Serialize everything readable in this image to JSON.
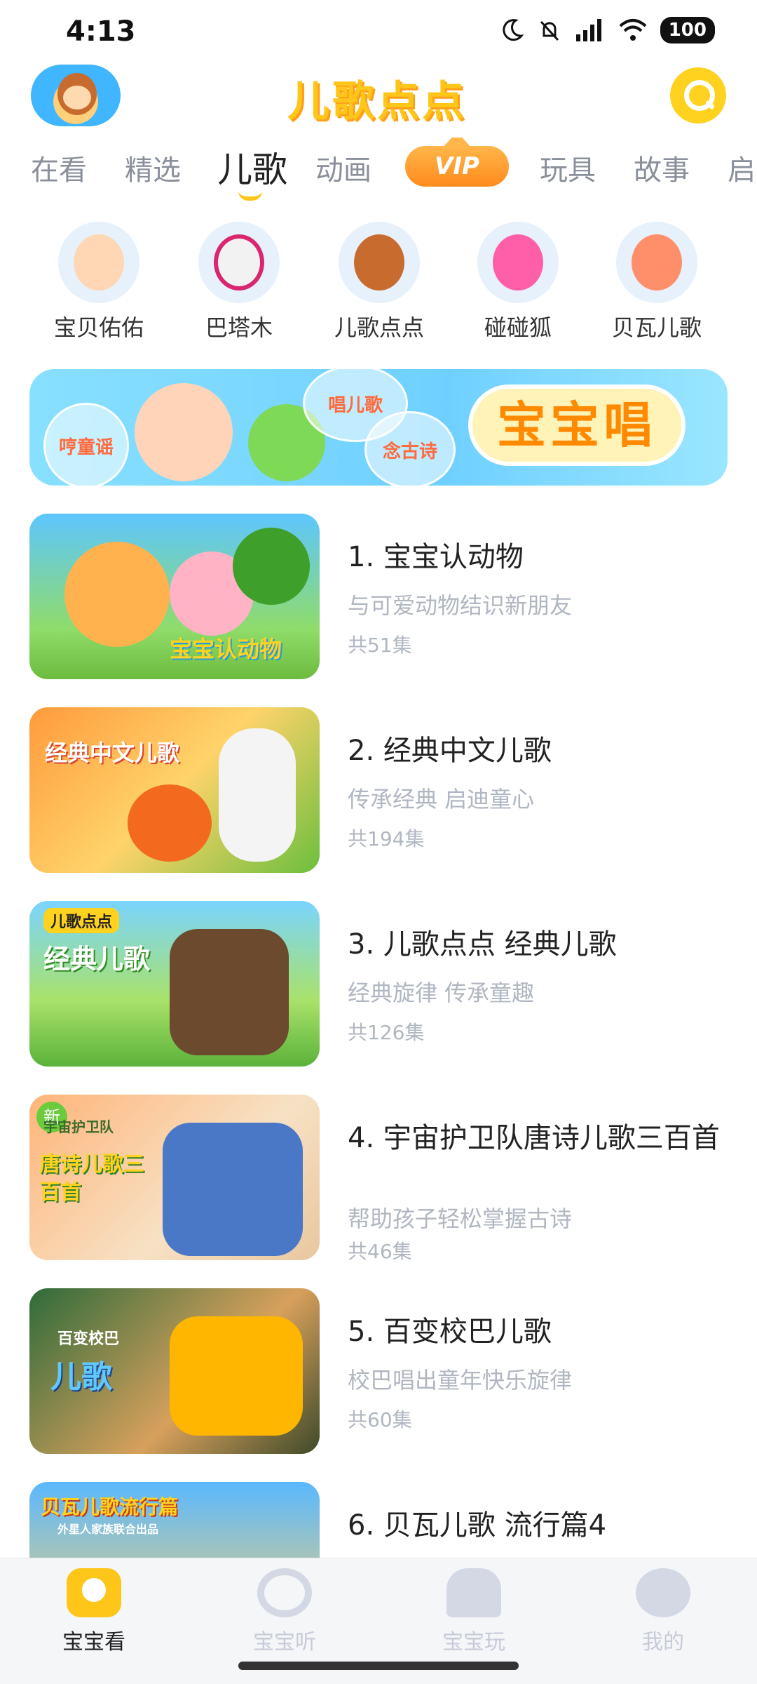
{
  "status_bar": {
    "time": "4:13",
    "battery": "100",
    "icons": [
      "moon-icon",
      "bell-off-icon",
      "signal-icon",
      "wifi-icon"
    ]
  },
  "header": {
    "logo_text": "儿歌点点",
    "search_icon": "search-icon",
    "accent": "#ffc61a"
  },
  "tabs": [
    {
      "label": "在看"
    },
    {
      "label": "精选"
    },
    {
      "label": "儿歌",
      "active": true
    },
    {
      "label": "动画"
    },
    {
      "label": "VIP"
    },
    {
      "label": "玩具"
    },
    {
      "label": "故事"
    },
    {
      "label": "启"
    }
  ],
  "characters": [
    {
      "name": "宝贝佑佑"
    },
    {
      "name": "巴塔木"
    },
    {
      "name": "儿歌点点"
    },
    {
      "name": "碰碰狐"
    },
    {
      "name": "贝瓦儿歌"
    }
  ],
  "banner": {
    "bubble_1": "哼童谣",
    "bubble_2": "唱儿歌",
    "bubble_3": "念古诗",
    "title": "宝宝唱"
  },
  "items": [
    {
      "title": "1. 宝宝认动物",
      "subtitle": "与可爱动物结识新朋友",
      "count": "共51集",
      "thumb_text": "宝宝认动物"
    },
    {
      "title": "2. 经典中文儿歌",
      "subtitle": "传承经典 启迪童心",
      "count": "共194集",
      "thumb_text": "经典中文儿歌"
    },
    {
      "title": "3. 儿歌点点 经典儿歌",
      "subtitle": "经典旋律 传承童趣",
      "count": "共126集",
      "thumb_text": "经典儿歌",
      "thumb_brand": "儿歌点点"
    },
    {
      "title": "4. 宇宙护卫队唐诗儿歌三百首",
      "subtitle": "帮助孩子轻松掌握古诗",
      "count": "共46集",
      "thumb_text": "唐诗儿歌三百首",
      "thumb_brand": "宇宙护卫队",
      "badge": "新"
    },
    {
      "title": "5. 百变校巴儿歌",
      "subtitle": "校巴唱出童年快乐旋律",
      "count": "共60集",
      "thumb_text": "儿歌",
      "thumb_brand": "百变校巴"
    },
    {
      "title": "6. 贝瓦儿歌 流行篇4",
      "subtitle": "",
      "count": "",
      "thumb_text": "贝瓦儿歌流行篇",
      "thumb_brand": "外星人家族联合出品"
    }
  ],
  "bottom_nav": [
    {
      "label": "宝宝看",
      "icon": "tv-icon",
      "active": true
    },
    {
      "label": "宝宝听",
      "icon": "headphones-icon"
    },
    {
      "label": "宝宝玩",
      "icon": "rocking-horse-icon"
    },
    {
      "label": "我的",
      "icon": "profile-icon"
    }
  ]
}
